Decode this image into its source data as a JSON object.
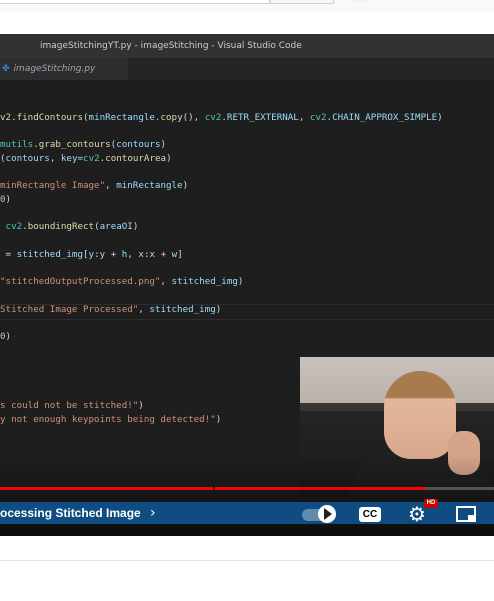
{
  "window": {
    "title": "imageStitchingYT.py - imageStitching - Visual Studio Code"
  },
  "editor": {
    "tab_label": "imageStitching.py",
    "tab_icon": "python-file-icon"
  },
  "code": [
    "v2.findContours(minRectangle.copy(), cv2.RETR_EXTERNAL, cv2.CHAIN_APPROX_SIMPLE)",
    "mutils.grab_contours(contours)",
    "(contours, key=cv2.contourArea)",
    "minRectangle Image\", minRectangle)",
    "0)",
    " cv2.boundingRect(areaOI)",
    " = stitched_img[y:y + h, x:x + w]",
    "\"stitchedOutputProcessed.png\", stitched_img)",
    "Stitched Image Processed\", stitched_img)",
    "0)",
    "s could not be stitched!\")",
    "y not enough keypoints being detected!\")"
  ],
  "player": {
    "chapter_title": "ocessing Stitched Image",
    "chapter_chevron": "›",
    "progress_fraction": 0.86,
    "chapter_gap_fraction": 0.43,
    "cc_label": "CC",
    "hd_label": "HD",
    "icons": [
      "autoplay-toggle-icon",
      "closed-captions-icon",
      "settings-gear-icon",
      "miniplayer-icon"
    ],
    "accent_color": "#ff0000"
  }
}
